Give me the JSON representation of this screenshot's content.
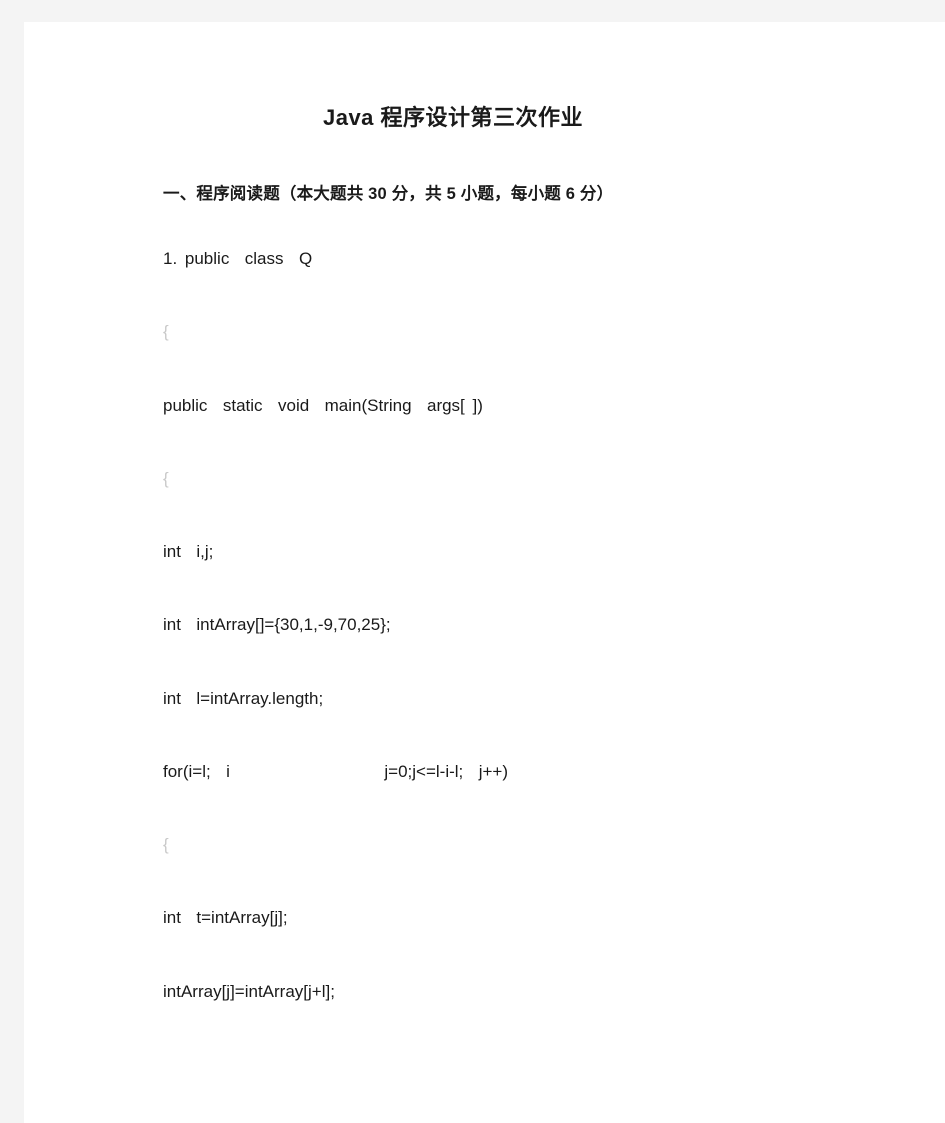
{
  "document": {
    "title": "Java 程序设计第三次作业",
    "section_heading": "一、程序阅读题（本大题共 30 分，共 5 小题，每小题 6 分）",
    "text_color": "#1a1a1a",
    "brace_color": "#c9c9c9",
    "page_background": "#ffffff",
    "canvas_background": "#f4f4f4",
    "lines": [
      {
        "id": "line-1",
        "text": "1. public  class  Q",
        "style": "normal"
      },
      {
        "id": "line-2",
        "text": "{",
        "style": "brace"
      },
      {
        "id": "line-3",
        "text": "public  static  void  main(String  args[ ])",
        "style": "normal"
      },
      {
        "id": "line-4",
        "text": "{",
        "style": "brace"
      },
      {
        "id": "line-5",
        "text": "int  i,j;",
        "style": "normal"
      },
      {
        "id": "line-6",
        "text": "int  intArray[]={30,1,-9,70,25};",
        "style": "normal"
      },
      {
        "id": "line-7",
        "text": "int  l=intArray.length;",
        "style": "normal"
      },
      {
        "id": "line-8",
        "text": "for(i=l;  i                    j=0;j<=l-i-l;  j++)",
        "style": "gapped"
      },
      {
        "id": "line-9",
        "text": "{",
        "style": "brace"
      },
      {
        "id": "line-10",
        "text": "int  t=intArray[j];",
        "style": "normal"
      },
      {
        "id": "line-11",
        "text": "intArray[j]=intArray[j+l];",
        "style": "normal"
      }
    ]
  }
}
